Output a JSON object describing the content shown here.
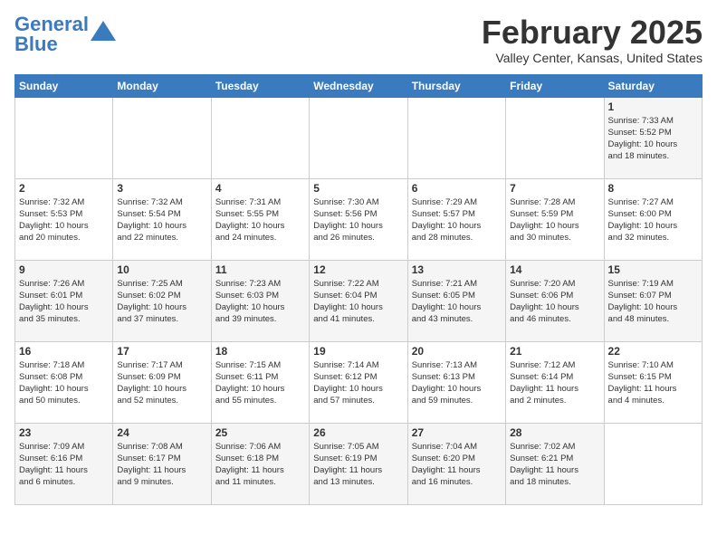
{
  "logo": {
    "line1": "General",
    "line2": "Blue"
  },
  "title": {
    "month_year": "February 2025",
    "location": "Valley Center, Kansas, United States"
  },
  "days_of_week": [
    "Sunday",
    "Monday",
    "Tuesday",
    "Wednesday",
    "Thursday",
    "Friday",
    "Saturday"
  ],
  "weeks": [
    [
      {
        "day": "",
        "info": ""
      },
      {
        "day": "",
        "info": ""
      },
      {
        "day": "",
        "info": ""
      },
      {
        "day": "",
        "info": ""
      },
      {
        "day": "",
        "info": ""
      },
      {
        "day": "",
        "info": ""
      },
      {
        "day": "1",
        "info": "Sunrise: 7:33 AM\nSunset: 5:52 PM\nDaylight: 10 hours\nand 18 minutes."
      }
    ],
    [
      {
        "day": "2",
        "info": "Sunrise: 7:32 AM\nSunset: 5:53 PM\nDaylight: 10 hours\nand 20 minutes."
      },
      {
        "day": "3",
        "info": "Sunrise: 7:32 AM\nSunset: 5:54 PM\nDaylight: 10 hours\nand 22 minutes."
      },
      {
        "day": "4",
        "info": "Sunrise: 7:31 AM\nSunset: 5:55 PM\nDaylight: 10 hours\nand 24 minutes."
      },
      {
        "day": "5",
        "info": "Sunrise: 7:30 AM\nSunset: 5:56 PM\nDaylight: 10 hours\nand 26 minutes."
      },
      {
        "day": "6",
        "info": "Sunrise: 7:29 AM\nSunset: 5:57 PM\nDaylight: 10 hours\nand 28 minutes."
      },
      {
        "day": "7",
        "info": "Sunrise: 7:28 AM\nSunset: 5:59 PM\nDaylight: 10 hours\nand 30 minutes."
      },
      {
        "day": "8",
        "info": "Sunrise: 7:27 AM\nSunset: 6:00 PM\nDaylight: 10 hours\nand 32 minutes."
      }
    ],
    [
      {
        "day": "9",
        "info": "Sunrise: 7:26 AM\nSunset: 6:01 PM\nDaylight: 10 hours\nand 35 minutes."
      },
      {
        "day": "10",
        "info": "Sunrise: 7:25 AM\nSunset: 6:02 PM\nDaylight: 10 hours\nand 37 minutes."
      },
      {
        "day": "11",
        "info": "Sunrise: 7:23 AM\nSunset: 6:03 PM\nDaylight: 10 hours\nand 39 minutes."
      },
      {
        "day": "12",
        "info": "Sunrise: 7:22 AM\nSunset: 6:04 PM\nDaylight: 10 hours\nand 41 minutes."
      },
      {
        "day": "13",
        "info": "Sunrise: 7:21 AM\nSunset: 6:05 PM\nDaylight: 10 hours\nand 43 minutes."
      },
      {
        "day": "14",
        "info": "Sunrise: 7:20 AM\nSunset: 6:06 PM\nDaylight: 10 hours\nand 46 minutes."
      },
      {
        "day": "15",
        "info": "Sunrise: 7:19 AM\nSunset: 6:07 PM\nDaylight: 10 hours\nand 48 minutes."
      }
    ],
    [
      {
        "day": "16",
        "info": "Sunrise: 7:18 AM\nSunset: 6:08 PM\nDaylight: 10 hours\nand 50 minutes."
      },
      {
        "day": "17",
        "info": "Sunrise: 7:17 AM\nSunset: 6:09 PM\nDaylight: 10 hours\nand 52 minutes."
      },
      {
        "day": "18",
        "info": "Sunrise: 7:15 AM\nSunset: 6:11 PM\nDaylight: 10 hours\nand 55 minutes."
      },
      {
        "day": "19",
        "info": "Sunrise: 7:14 AM\nSunset: 6:12 PM\nDaylight: 10 hours\nand 57 minutes."
      },
      {
        "day": "20",
        "info": "Sunrise: 7:13 AM\nSunset: 6:13 PM\nDaylight: 10 hours\nand 59 minutes."
      },
      {
        "day": "21",
        "info": "Sunrise: 7:12 AM\nSunset: 6:14 PM\nDaylight: 11 hours\nand 2 minutes."
      },
      {
        "day": "22",
        "info": "Sunrise: 7:10 AM\nSunset: 6:15 PM\nDaylight: 11 hours\nand 4 minutes."
      }
    ],
    [
      {
        "day": "23",
        "info": "Sunrise: 7:09 AM\nSunset: 6:16 PM\nDaylight: 11 hours\nand 6 minutes."
      },
      {
        "day": "24",
        "info": "Sunrise: 7:08 AM\nSunset: 6:17 PM\nDaylight: 11 hours\nand 9 minutes."
      },
      {
        "day": "25",
        "info": "Sunrise: 7:06 AM\nSunset: 6:18 PM\nDaylight: 11 hours\nand 11 minutes."
      },
      {
        "day": "26",
        "info": "Sunrise: 7:05 AM\nSunset: 6:19 PM\nDaylight: 11 hours\nand 13 minutes."
      },
      {
        "day": "27",
        "info": "Sunrise: 7:04 AM\nSunset: 6:20 PM\nDaylight: 11 hours\nand 16 minutes."
      },
      {
        "day": "28",
        "info": "Sunrise: 7:02 AM\nSunset: 6:21 PM\nDaylight: 11 hours\nand 18 minutes."
      },
      {
        "day": "",
        "info": ""
      }
    ]
  ]
}
